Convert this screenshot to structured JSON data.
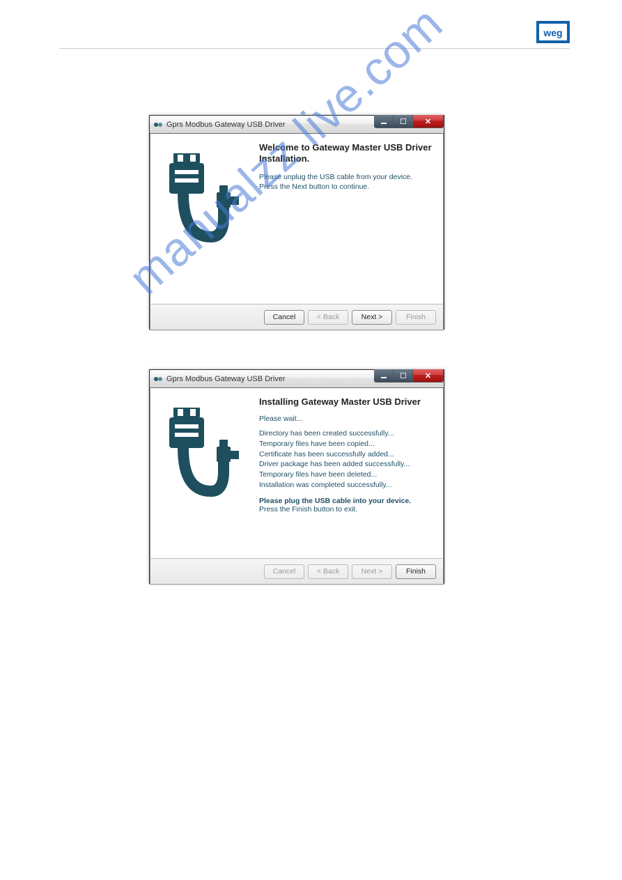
{
  "logo_text": "WEG",
  "watermark_text": "manualzz live.com",
  "dialog1": {
    "title": "Gprs Modbus Gateway USB Driver",
    "heading": "Welcome to Gateway Master USB Driver Installation.",
    "instruction": "Please unplug the USB cable from your device. Press the Next button to continue.",
    "buttons": {
      "cancel": "Cancel",
      "back": "< Back",
      "next": "Next >",
      "finish": "Finish"
    }
  },
  "dialog2": {
    "title": "Gprs Modbus Gateway USB Driver",
    "heading": "Installing Gateway Master USB Driver",
    "wait": "Please wait...",
    "status": [
      "Directory has been created successfully...",
      "Temporary files have been copied...",
      "Certificate has been successfully added...",
      "Driver package has been added successfully...",
      "Temporary files have been deleted...",
      "Installation was completed successfully..."
    ],
    "plug": "Please plug the USB cable into your device.",
    "press_finish": "Press the Finish button to exit.",
    "buttons": {
      "cancel": "Cancel",
      "back": "< Back",
      "next": "Next >",
      "finish": "Finish"
    }
  }
}
